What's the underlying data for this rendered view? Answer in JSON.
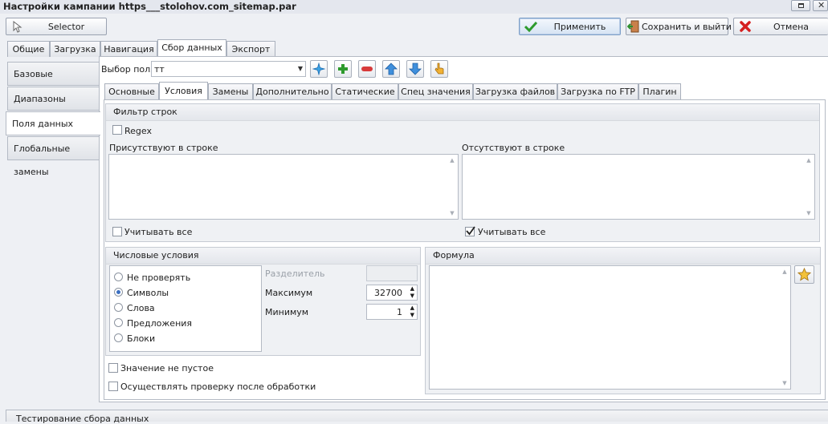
{
  "window": {
    "title": "Настройки кампании https___stolohov.com_sitemap.par"
  },
  "toolbar": {
    "selector_label": "Selector",
    "apply_label": "Применить",
    "save_exit_label": "Сохранить и выйти",
    "cancel_label": "Отмена"
  },
  "main_tabs": [
    "Общие",
    "Загрузка",
    "Навигация",
    "Сбор данных",
    "Экспорт"
  ],
  "sidebar": {
    "items": [
      "Базовые",
      "Диапазоны",
      "Поля данных",
      "Глобальные замены"
    ]
  },
  "field_select": {
    "label": "Выбор поля",
    "value": "тт"
  },
  "sub_tabs": [
    "Основные",
    "Условия",
    "Замены",
    "Дополнительно",
    "Статические",
    "Спец значения",
    "Загрузка файлов",
    "Загрузка по FTP",
    "Плагин"
  ],
  "row_filter": {
    "title": "Фильтр строк",
    "regex_label": "Regex",
    "present_label": "Присутствуют в строке",
    "absent_label": "Отсутствуют в строке",
    "consider_all_left": "Учитывать все",
    "consider_all_right": "Учитывать все"
  },
  "numeric": {
    "title": "Числовые условия",
    "options": [
      "Не проверять",
      "Символы",
      "Слова",
      "Предложения",
      "Блоки"
    ],
    "selected": "Символы",
    "separator_label": "Разделитель",
    "max_label": "Максимум",
    "max_value": "32700",
    "min_label": "Минимум",
    "min_value": "1"
  },
  "formula": {
    "title": "Формула"
  },
  "options": {
    "not_empty": "Значение не пустое",
    "check_after": "Осуществлять проверку после обработки"
  },
  "bottom": {
    "label": "Тестирование сбора данных"
  }
}
